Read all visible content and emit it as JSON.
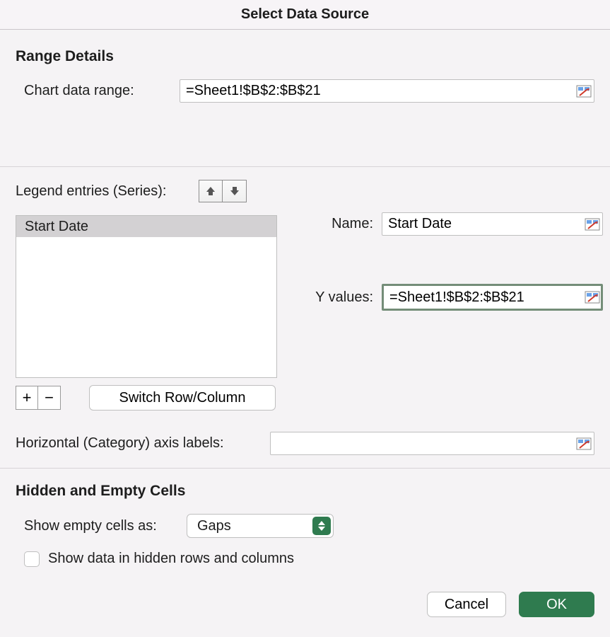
{
  "dialog_title": "Select Data Source",
  "range_details": {
    "heading": "Range Details",
    "chart_range_label": "Chart data range:",
    "chart_range_value": "=Sheet1!$B$2:$B$21"
  },
  "series": {
    "legend_label": "Legend entries (Series):",
    "items": [
      "Start Date"
    ],
    "add_label": "+",
    "remove_label": "−",
    "switch_label": "Switch Row/Column",
    "name_label": "Name:",
    "name_value": "Start Date",
    "y_label": "Y values:",
    "y_value": "=Sheet1!$B$2:$B$21"
  },
  "axis_labels": {
    "label": "Horizontal (Category) axis labels:",
    "value": ""
  },
  "hidden": {
    "heading": "Hidden and Empty Cells",
    "show_empty_label": "Show empty cells as:",
    "show_empty_value": "Gaps",
    "checkbox_label": "Show data in hidden rows and columns"
  },
  "footer": {
    "cancel": "Cancel",
    "ok": "OK"
  }
}
